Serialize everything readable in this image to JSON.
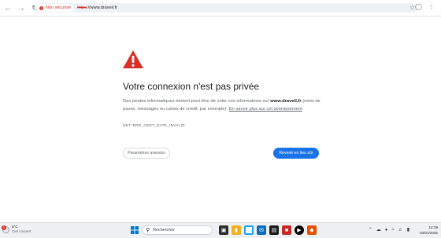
{
  "toolbar": {
    "security_chip_label": "Non sécurisé",
    "url_scheme": "https",
    "url_rest": "://www.draveil.fr",
    "icons": [
      "back-arrow-icon",
      "forward-arrow-icon",
      "reload-icon",
      "star-icon",
      "profile-icon",
      "more-icon"
    ]
  },
  "interstitial": {
    "title": "Votre connexion n'est pas privée",
    "body_part1": "Des pirates informatiques tentent peut-être de voler vos informations sur ",
    "body_domain": "www.draveil.fr",
    "body_part2": " (mots de passe, messages ou cartes de crédit, par exemple). ",
    "body_link": "En savoir plus sur cet avertissement",
    "error_code": "NET::ERR_CERT_DATE_INVALID",
    "advanced_button": "Paramètres avancés",
    "back_button": "Revenir en lieu sûr"
  },
  "taskbar": {
    "weather_temp": "5°C",
    "weather_condition": "Ciel couvert",
    "weather_badge": "1",
    "search_label": "Rechercher",
    "time": "14:39",
    "date": "03/01/2025"
  },
  "colors": {
    "danger": "#d93025",
    "primary": "#1a73e8",
    "warning_triangle": "#d93025"
  }
}
